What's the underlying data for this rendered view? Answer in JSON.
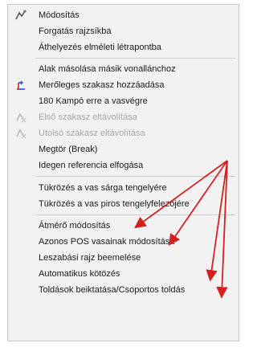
{
  "menu": {
    "group1": [
      {
        "label": "Módosítás",
        "icon": "modify-icon",
        "enabled": true
      },
      {
        "label": "Forgatás rajzsíkba",
        "icon": "",
        "enabled": true
      },
      {
        "label": "Áthelyezés elméleti létrapontba",
        "icon": "",
        "enabled": true
      }
    ],
    "group2": [
      {
        "label": "Alak másolása másik vonallánchoz",
        "icon": "",
        "enabled": true
      },
      {
        "label": "Merőleges szakasz hozzáadása",
        "icon": "add-perpendicular-icon",
        "enabled": true
      },
      {
        "label": "180 Kampó erre a vasvégre",
        "icon": "",
        "enabled": true
      },
      {
        "label": "Első szakasz eltávolítása",
        "icon": "remove-first-segment-icon",
        "enabled": false
      },
      {
        "label": "Utolsó szakasz eltávolítása",
        "icon": "remove-last-segment-icon",
        "enabled": false
      },
      {
        "label": "Megtör (Break)",
        "icon": "",
        "enabled": true
      },
      {
        "label": "Idegen referencia elfogása",
        "icon": "",
        "enabled": true
      }
    ],
    "group3": [
      {
        "label": "Tükrözés a vas sárga tengelyére",
        "icon": "",
        "enabled": true
      },
      {
        "label": "Tükrözés a vas piros tengelyfelezőjére",
        "icon": "",
        "enabled": true
      },
      {
        "label": "Átmérő módosítás",
        "icon": "",
        "enabled": true
      },
      {
        "label": "Azonos POS vasainak módosítása",
        "icon": "",
        "enabled": true
      },
      {
        "label": "Leszabási rajz beemelése",
        "icon": "",
        "enabled": true
      },
      {
        "label": "Automatikus kötözés",
        "icon": "",
        "enabled": true
      },
      {
        "label": "Toldások beiktatása/Csoportos toldás",
        "icon": "",
        "enabled": true
      }
    ]
  },
  "colors": {
    "menu_background": "#f2f2f2",
    "enabled_text": "#1a1a1a",
    "disabled_text": "#a6a6a6",
    "annotation_arrow": "#d42020"
  }
}
